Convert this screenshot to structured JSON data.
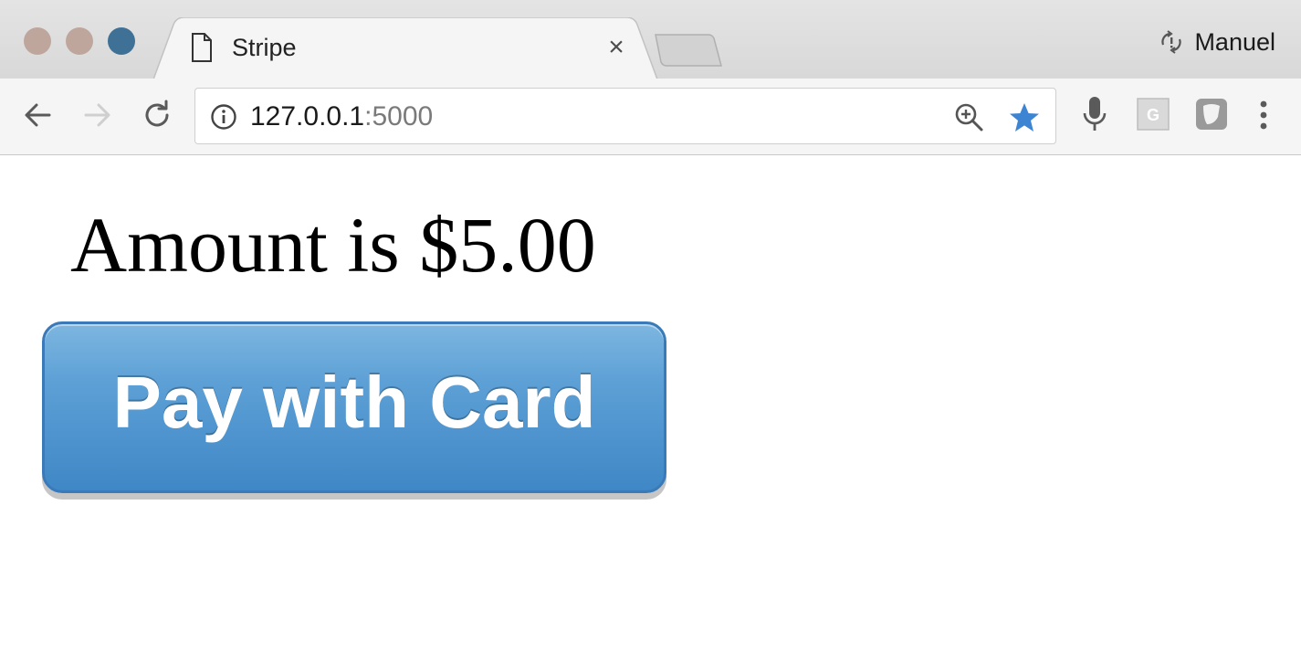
{
  "window": {
    "tab_title": "Stripe",
    "profile_name": "Manuel"
  },
  "toolbar": {
    "url_host": "127.0.0.1",
    "url_port": ":5000"
  },
  "page": {
    "heading": "Amount is $5.00",
    "pay_button_label": "Pay with Card"
  },
  "colors": {
    "pay_button": "#4a90cc",
    "star_accent": "#3d84d2"
  },
  "icons": [
    "document-icon",
    "close-icon",
    "back-arrow-icon",
    "forward-arrow-icon",
    "reload-icon",
    "info-icon",
    "zoom-in-icon",
    "star-icon",
    "microphone-icon",
    "extension-g-icon",
    "extension-shield-icon",
    "menu-dots-icon",
    "sync-icon"
  ]
}
